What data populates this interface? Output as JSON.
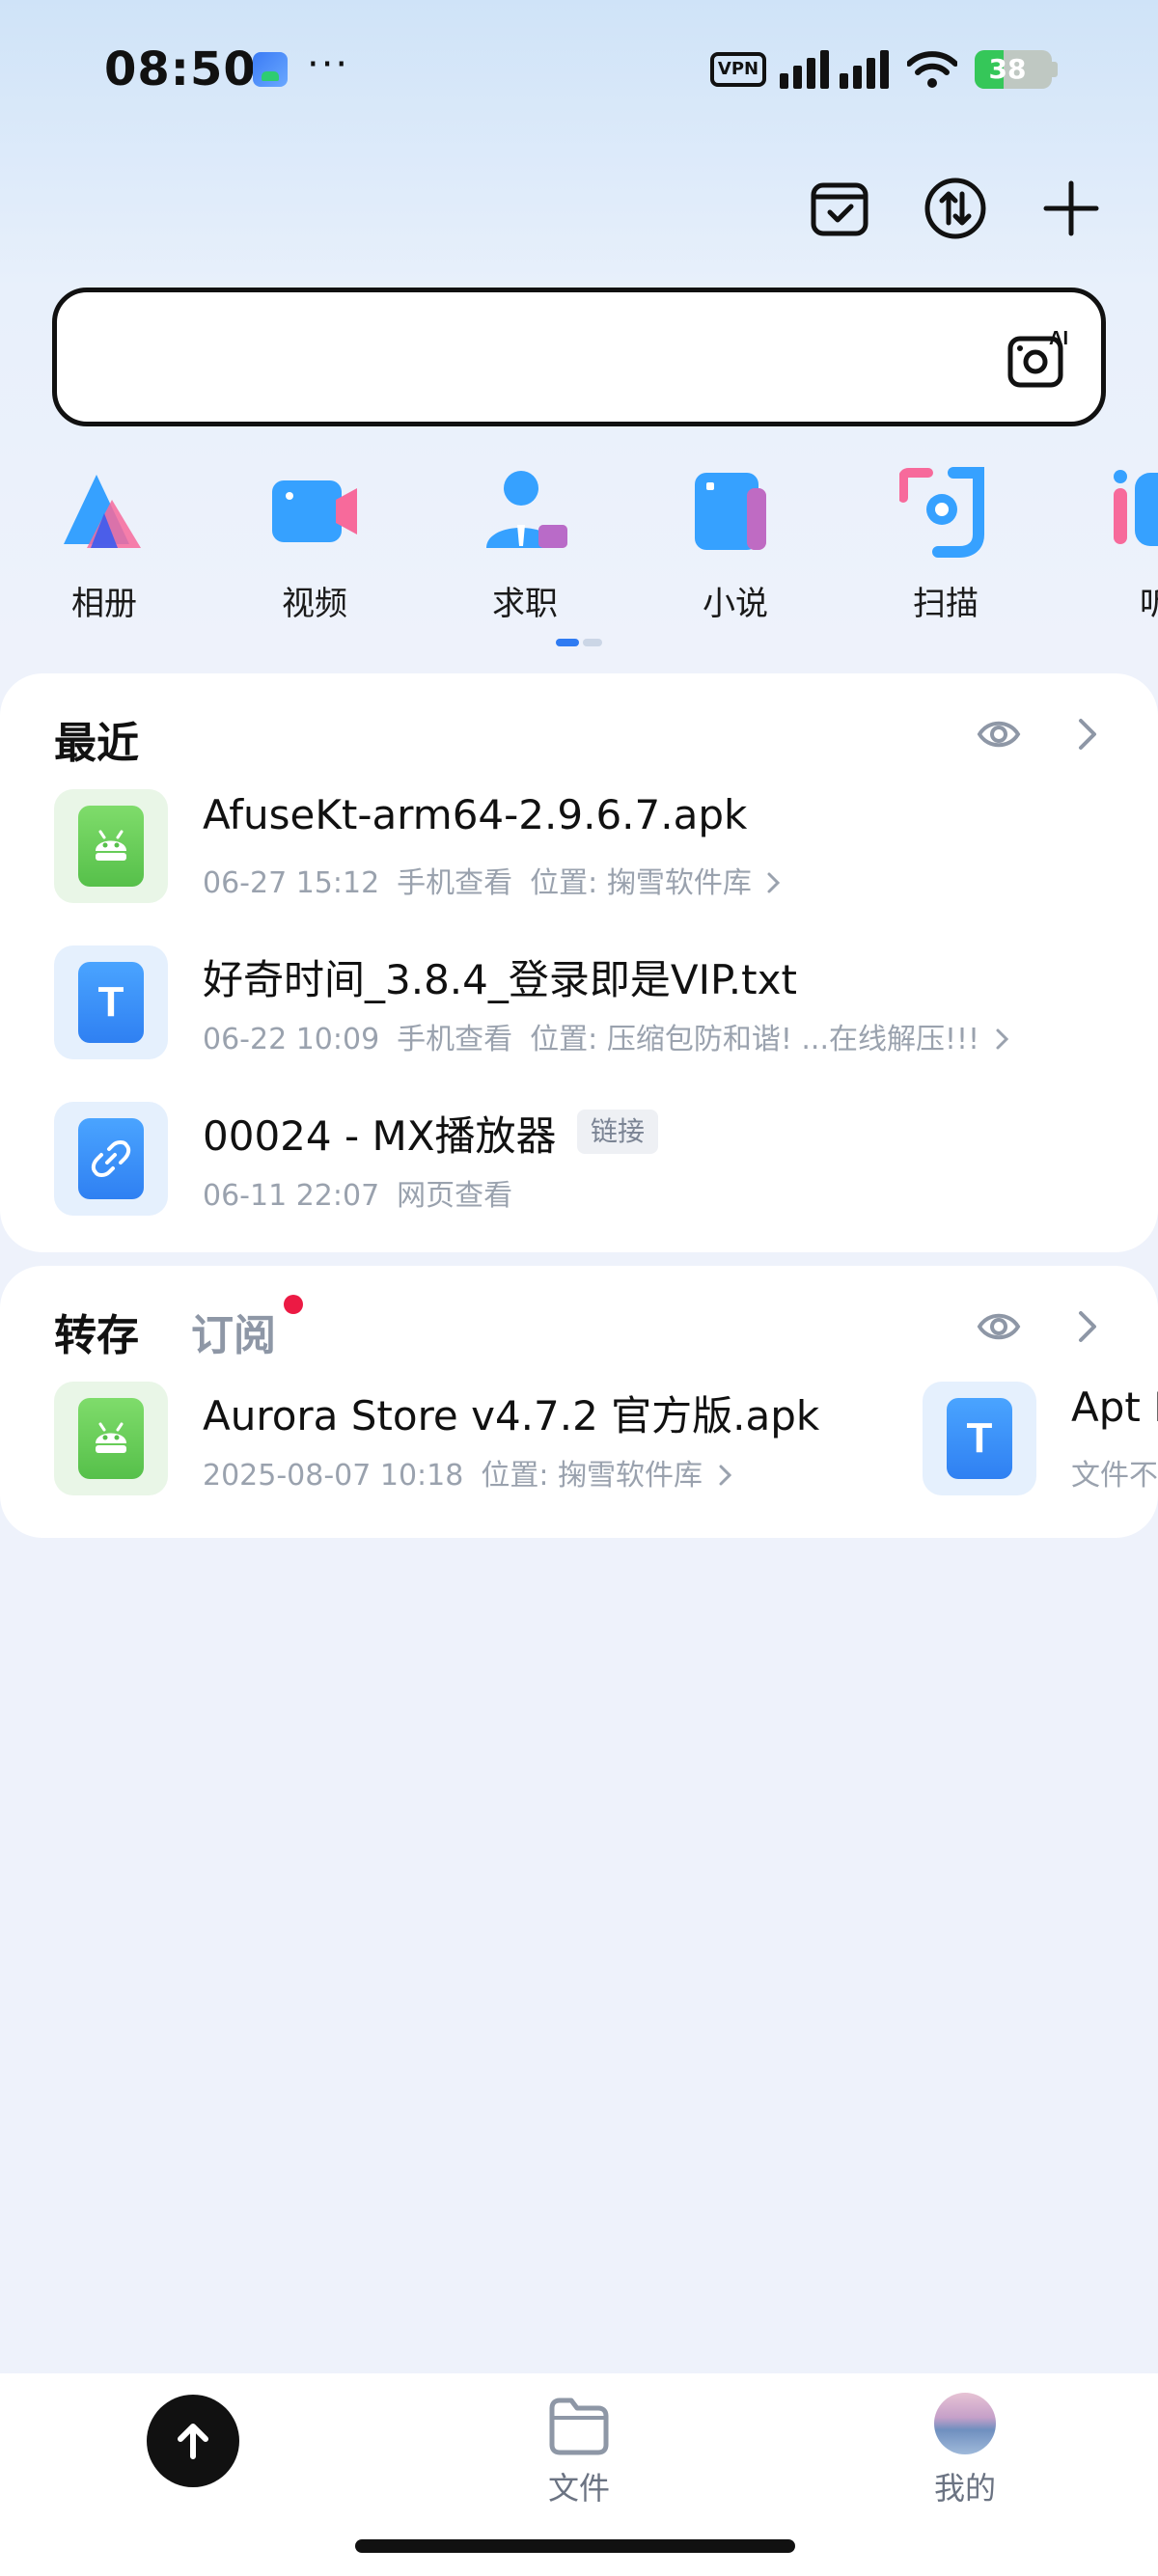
{
  "status_bar": {
    "time": "08:50",
    "dots": "···",
    "vpn": "VPN",
    "battery": "38",
    "battery_level": 0.38
  },
  "search": {
    "placeholder": ""
  },
  "categories": [
    {
      "label": "相册",
      "icon": "album-icon"
    },
    {
      "label": "视频",
      "icon": "video-icon"
    },
    {
      "label": "求职",
      "icon": "job-icon"
    },
    {
      "label": "小说",
      "icon": "novel-icon"
    },
    {
      "label": "扫描",
      "icon": "scan-icon"
    },
    {
      "label": "听",
      "icon": "listen-icon"
    }
  ],
  "recent": {
    "title": "最近",
    "items": [
      {
        "name": "AfuseKt-arm64-2.9.6.7.apk",
        "date": "06-27 15:12",
        "view": "手机查看",
        "location": "位置: 掬雪软件库",
        "type": "apk"
      },
      {
        "name": "好奇时间_3.8.4_登录即是VIP.txt",
        "date": "06-22 10:09",
        "view": "手机查看",
        "location": "位置: 压缩包防和谐! ...在线解压!!!",
        "type": "txt"
      },
      {
        "name": "00024 - MX播放器",
        "tag": "链接",
        "date": "06-11 22:07",
        "view": "网页查看",
        "type": "link"
      }
    ]
  },
  "saved": {
    "title": "转存",
    "tab_subscribe": "订阅",
    "items": [
      {
        "name": "Aurora Store v4.7.2 官方版.apk",
        "date": "2025-08-07 10:18",
        "location": "位置: 掬雪软件库",
        "type": "apk"
      },
      {
        "name": "Apt F",
        "meta": "文件不",
        "type": "txt"
      }
    ]
  },
  "bottom_nav": {
    "files": "文件",
    "mine": "我的"
  }
}
